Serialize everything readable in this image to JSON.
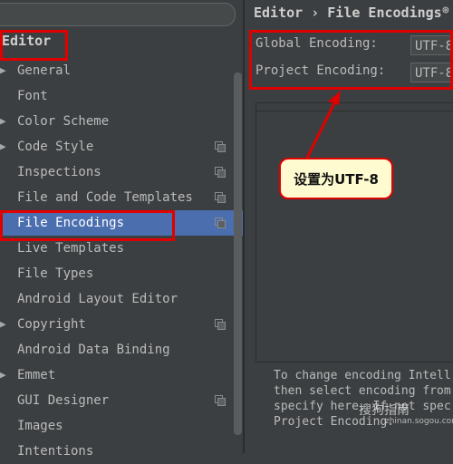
{
  "sidebar": {
    "section_title": "Editor",
    "items": [
      {
        "label": "General",
        "arrow": "▶",
        "config": false,
        "selected": false
      },
      {
        "label": "Font",
        "arrow": "",
        "config": false,
        "selected": false
      },
      {
        "label": "Color Scheme",
        "arrow": "▶",
        "config": false,
        "selected": false
      },
      {
        "label": "Code Style",
        "arrow": "▶",
        "config": true,
        "selected": false
      },
      {
        "label": "Inspections",
        "arrow": "",
        "config": true,
        "selected": false
      },
      {
        "label": "File and Code Templates",
        "arrow": "",
        "config": true,
        "selected": false
      },
      {
        "label": "File Encodings",
        "arrow": "",
        "config": true,
        "selected": true
      },
      {
        "label": "Live Templates",
        "arrow": "",
        "config": false,
        "selected": false
      },
      {
        "label": "File Types",
        "arrow": "",
        "config": false,
        "selected": false
      },
      {
        "label": "Android Layout Editor",
        "arrow": "",
        "config": false,
        "selected": false
      },
      {
        "label": "Copyright",
        "arrow": "▶",
        "config": true,
        "selected": false
      },
      {
        "label": "Android Data Binding",
        "arrow": "",
        "config": false,
        "selected": false
      },
      {
        "label": "Emmet",
        "arrow": "▶",
        "config": false,
        "selected": false
      },
      {
        "label": "GUI Designer",
        "arrow": "",
        "config": true,
        "selected": false
      },
      {
        "label": "Images",
        "arrow": "",
        "config": false,
        "selected": false
      },
      {
        "label": "Intentions",
        "arrow": "",
        "config": false,
        "selected": false
      }
    ]
  },
  "header": {
    "breadcrumb": "Editor › File Encodings",
    "help_icon": "⊛"
  },
  "settings": {
    "global_label": "Global Encoding:",
    "global_value": "UTF-8",
    "project_label": "Project Encoding:",
    "project_value": "UTF-8"
  },
  "footer_text": "To change encoding Intell\nthen select encoding from\nspecify here. If not spec\nProject Encoding.",
  "annotation": {
    "callout_text": "设置为UTF-8",
    "highlight_color": "#e00000"
  },
  "watermark": {
    "text": "搜狗指南",
    "sub": "zhinan.sogou.com"
  }
}
